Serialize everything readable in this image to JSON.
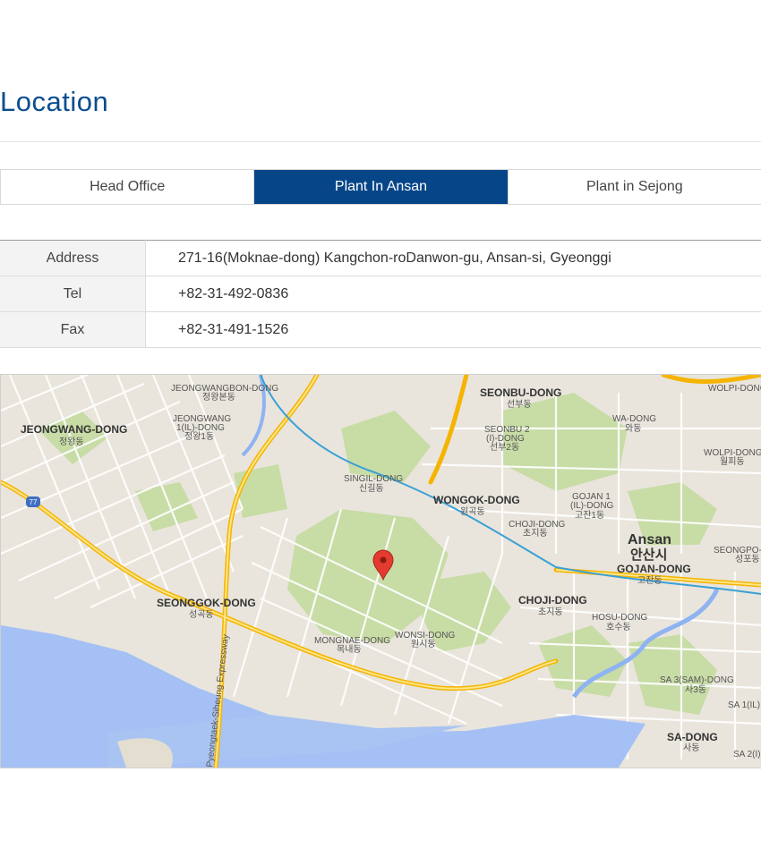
{
  "page": {
    "title": "Location"
  },
  "tabs": [
    {
      "label": "Head Office",
      "active": false
    },
    {
      "label": "Plant In Ansan",
      "active": true
    },
    {
      "label": "Plant in Sejong",
      "active": false
    }
  ],
  "info": {
    "address_label": "Address",
    "address": "271-16(Moknae-dong) Kangchon-roDanwon-gu, Ansan-si, Gyeonggi",
    "tel_label": "Tel",
    "tel": "+82-31-492-0836",
    "fax_label": "Fax",
    "fax": "+82-31-491-1526"
  },
  "map": {
    "labels": {
      "jeongwangbon": "JEONGWANGBON-DONG",
      "jeongwangbon_ko": "정왕본동",
      "jeongwang": "JEONGWANG-DONG",
      "jeongwang_ko": "정왕동",
      "jeongwang1": "JEONGWANG",
      "jeongwang1b": "1(IL)-DONG",
      "jeongwang1_ko": "정왕1동",
      "seonbu": "SEONBU-DONG",
      "seonbu_ko": "선부동",
      "seonbu2": "SEONBU 2",
      "seonbu2b": "(I)-DONG",
      "seonbu2_ko": "선부2동",
      "wa": "WA-DONG",
      "wa_ko": "와동",
      "wolpi": "WOLPI-DONG",
      "wolpi_ko": "월피동",
      "singil": "SINGIL-DONG",
      "singil_ko": "신길동",
      "wongok": "WONGOK-DONG",
      "wongok_ko": "원곡동",
      "gojan1": "GOJAN 1",
      "gojan1b": "(IL)-DONG",
      "gojan1_ko": "고잔1동",
      "choji_n": "CHOJI-DONG",
      "choji_n_ko": "초지동",
      "ansan": "Ansan",
      "ansan_ko": "안산시",
      "gojan": "GOJAN-DONG",
      "gojan_ko": "고잔동",
      "seonggok": "SEONGGOK-DONG",
      "seonggok_ko": "성곡동",
      "choji": "CHOJI-DONG",
      "choji_ko": "초지동",
      "hosu": "HOSU-DONG",
      "hosu_ko": "호수동",
      "mongnae": "MONGNAE-DONG",
      "mongnae_ko": "목내동",
      "wonsi": "WONSI-DONG",
      "wonsi_ko": "원시동",
      "sa3": "SA 3(SAM)-DONG",
      "sa3_ko": "사3동",
      "sa": "SA-DONG",
      "sa_ko": "사동",
      "seongpo": "SEONGPO-",
      "seongpo_ko": "성포동",
      "sa1": "SA 1(IL)",
      "sa2": "SA 2(I)",
      "route": "77",
      "expressway": "Pyeongtaek-Siheung Expressway"
    },
    "marker": "red-pin"
  }
}
